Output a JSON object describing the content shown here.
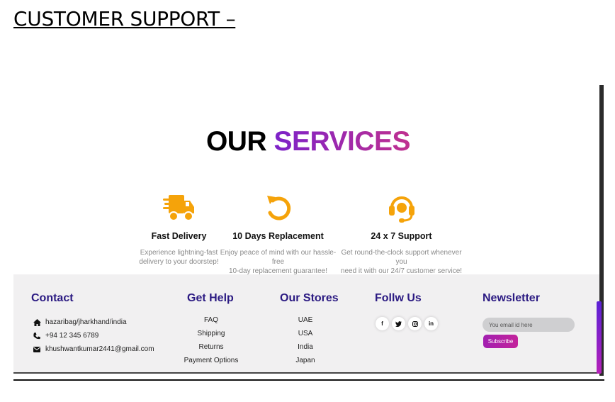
{
  "doc_heading": "CUSTOMER SUPPORT –",
  "services": {
    "title_part1": "OUR",
    "title_part2": "SERVICES",
    "items": [
      {
        "icon": "delivery-truck-icon",
        "title": "Fast Delivery",
        "desc_line1": "Experience lightning-fast",
        "desc_line2": "delivery to your doorstep!"
      },
      {
        "icon": "replacement-arrow-icon",
        "title": "10 Days Replacement",
        "desc_line1": "Enjoy peace of mind with our hassle-free",
        "desc_line2": "10-day replacement guarantee!"
      },
      {
        "icon": "headset-icon",
        "title": "24 x 7 Support",
        "desc_line1": "Get round-the-clock support whenever you",
        "desc_line2": "need it with our 24/7 customer service!"
      }
    ]
  },
  "footer": {
    "contact": {
      "title": "Contact",
      "address": "hazaribag/jharkhand/india",
      "phone": "+94 12 345 6789",
      "email": "khushwantkumar2441@gmail.com"
    },
    "help": {
      "title": "Get Help",
      "links": [
        "FAQ",
        "Shipping",
        "Returns",
        "Payment Options"
      ]
    },
    "stores": {
      "title": "Our Stores",
      "links": [
        "UAE",
        "USA",
        "India",
        "Japan"
      ]
    },
    "follow": {
      "title": "Follw Us",
      "icons": [
        "facebook-icon",
        "twitter-icon",
        "instagram-icon",
        "linkedin-icon"
      ]
    },
    "newsletter": {
      "title": "Newsletter",
      "placeholder": "You email id here",
      "button": "Subscribe"
    }
  },
  "colors": {
    "accent_orange": "#f5a30a",
    "heading_navy": "#2b1a82",
    "gradient_purple": "#7c22c9",
    "gradient_pink": "#c0308f",
    "footer_bg": "#f1f0f1"
  }
}
